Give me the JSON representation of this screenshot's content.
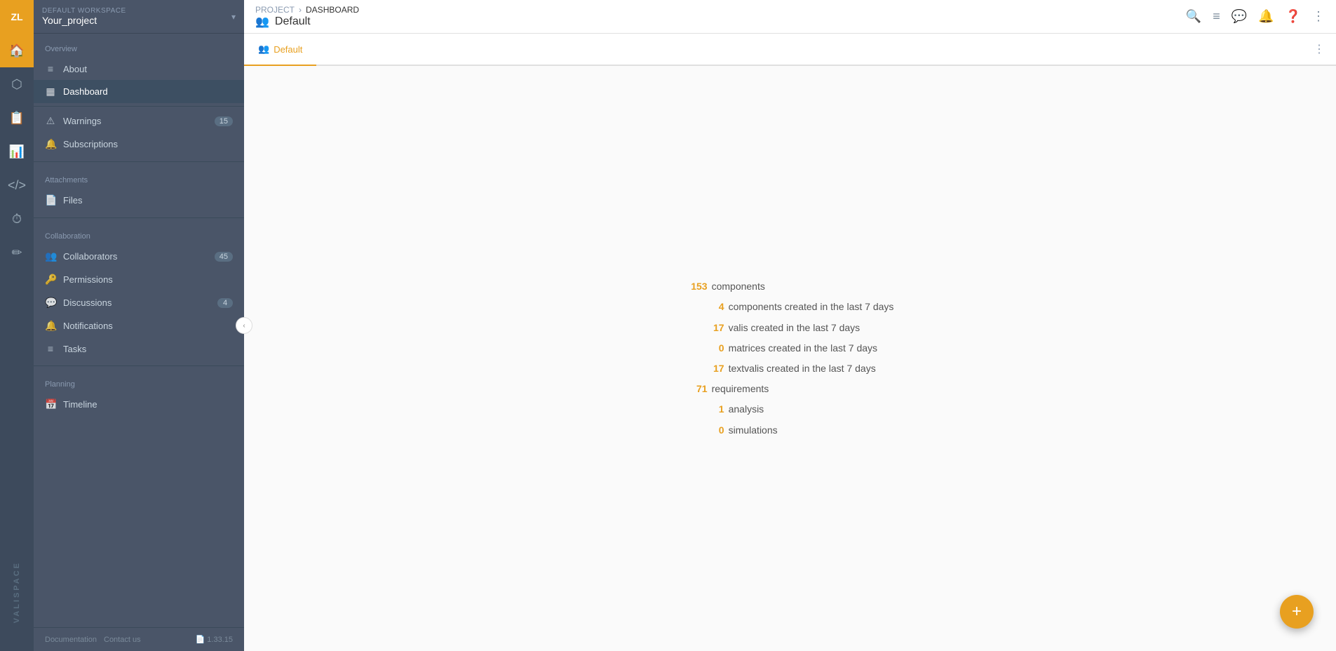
{
  "workspace": {
    "label": "DEFAULT WORKSPACE",
    "name": "Your_project"
  },
  "avatar": {
    "initials": "ZL"
  },
  "sidebar": {
    "overview_section": "Overview",
    "items_overview": [
      {
        "id": "about",
        "label": "About",
        "icon": "≡",
        "badge": null
      },
      {
        "id": "dashboard",
        "label": "Dashboard",
        "icon": "▦",
        "badge": null,
        "active": true
      }
    ],
    "items_warnings": [
      {
        "id": "warnings",
        "label": "Warnings",
        "icon": "⚠",
        "badge": "15"
      },
      {
        "id": "subscriptions",
        "label": "Subscriptions",
        "icon": "🔔",
        "badge": null
      }
    ],
    "attachments_section": "Attachments",
    "items_attachments": [
      {
        "id": "files",
        "label": "Files",
        "icon": "📄",
        "badge": null
      }
    ],
    "collaboration_section": "Collaboration",
    "items_collaboration": [
      {
        "id": "collaborators",
        "label": "Collaborators",
        "icon": "👥",
        "badge": "45"
      },
      {
        "id": "permissions",
        "label": "Permissions",
        "icon": "🔑",
        "badge": null
      },
      {
        "id": "discussions",
        "label": "Discussions",
        "icon": "💬",
        "badge": "4"
      },
      {
        "id": "notifications",
        "label": "Notifications",
        "icon": "🔔",
        "badge": null
      },
      {
        "id": "tasks",
        "label": "Tasks",
        "icon": "≡",
        "badge": null
      }
    ],
    "planning_section": "Planning",
    "items_planning": [
      {
        "id": "timeline",
        "label": "Timeline",
        "icon": "📅",
        "badge": null
      }
    ],
    "footer": {
      "documentation": "Documentation",
      "contact": "Contact us",
      "version": "1.33.15"
    }
  },
  "breadcrumb": {
    "project": "PROJECT",
    "separator": "›",
    "current": "DASHBOARD"
  },
  "header": {
    "icon": "👥",
    "title": "Default"
  },
  "tabs": [
    {
      "id": "default",
      "label": "Default",
      "icon": "👥",
      "active": true
    }
  ],
  "topbar_icons": {
    "search": "🔍",
    "list": "≡",
    "chat": "💬",
    "bell": "🔔",
    "help": "?"
  },
  "stats": [
    {
      "num": "153",
      "label": "components"
    },
    {
      "num": "4",
      "label": "components created in the last 7 days",
      "indent": true
    },
    {
      "num": "17",
      "label": "valis created in the last 7 days",
      "indent": true
    },
    {
      "num": "0",
      "label": "matrices created in the last 7 days",
      "indent": true
    },
    {
      "num": "17",
      "label": "textvalis created in the last 7 days",
      "indent": true
    },
    {
      "num": "71",
      "label": "requirements"
    },
    {
      "num": "1",
      "label": "analysis",
      "indent": true
    },
    {
      "num": "0",
      "label": "simulations",
      "indent": true
    }
  ],
  "fab_label": "+",
  "brand": "VALISPACE"
}
